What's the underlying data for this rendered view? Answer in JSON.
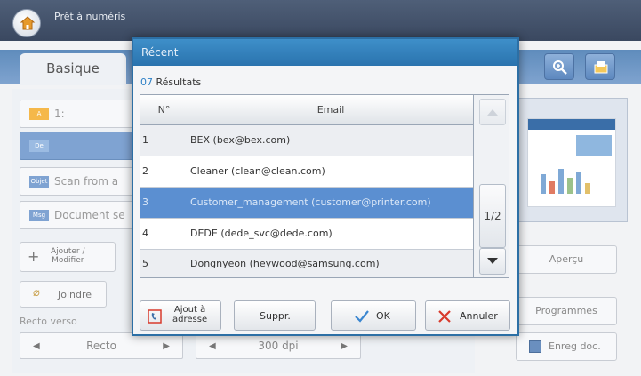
{
  "app": {
    "title": "Prêt à numéris"
  },
  "tabs": {
    "basique": "Basique"
  },
  "left": {
    "row1_tag": "A",
    "row1_text": "1:",
    "row2_tag": "De",
    "row3_tag": "Objet",
    "row3_text": "Scan from a",
    "row4_tag": "Msg",
    "row4_text": "Document se",
    "add_modify": "Ajouter /\nModifier",
    "attach": "Joindre",
    "recto_verso": "Recto verso",
    "recto": "Recto",
    "dpi": "300 dpi"
  },
  "right": {
    "apercu": "Aperçu",
    "programmes": "Programmes",
    "enreg_doc": "Enreg doc."
  },
  "dialog": {
    "title": "Récent",
    "results_count": "07",
    "results_label": " Résultats",
    "col_num": "N°",
    "col_email": "Email",
    "page": "1/2",
    "rows": [
      {
        "num": "1",
        "email": "BEX (bex@bex.com)"
      },
      {
        "num": "2",
        "email": "Cleaner (clean@clean.com)"
      },
      {
        "num": "3",
        "email": "Customer_management (customer@printer.com)"
      },
      {
        "num": "4",
        "email": "DEDE (dede_svc@dede.com)"
      },
      {
        "num": "5",
        "email": "Dongnyeon (heywood@samsung.com)"
      }
    ],
    "btn_add_address": "Ajout à\nadresse",
    "btn_delete": "Suppr.",
    "btn_ok": "OK",
    "btn_cancel": "Annuler"
  },
  "colors": {
    "dialog_title": "#2a73ae",
    "selected_row": "#5b8fd1",
    "ok_check": "#3a86d0",
    "cancel_x": "#d83a2c"
  }
}
